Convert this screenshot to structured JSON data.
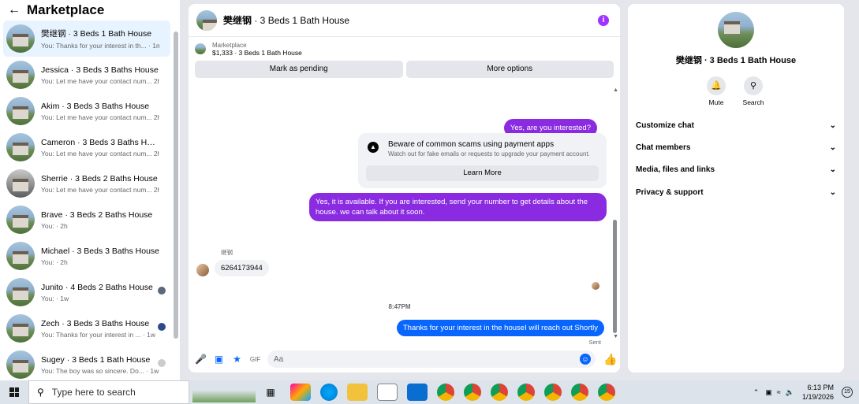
{
  "left": {
    "title": "Marketplace",
    "conversations": [
      {
        "title": "樊继钢 · 3 Beds 1 Bath House",
        "sub": "You: Thanks for your interest in th... · 1m"
      },
      {
        "title": "Jessica · 3 Beds 3 Baths House",
        "sub": "You: Let me have your contact num... 2h"
      },
      {
        "title": "Akim · 3 Beds 3 Baths House",
        "sub": "You: Let me have your contact num... 2h"
      },
      {
        "title": "Cameron · 3 Beds 3 Baths House",
        "sub": "You: Let me have your contact num... 2h"
      },
      {
        "title": "Sherrie · 3 Beds 2 Baths House",
        "sub": "You: Let me have your contact num... 2h"
      },
      {
        "title": "Brave · 3 Beds 2 Baths House",
        "sub": "You: · 2h"
      },
      {
        "title": "Michael · 3 Beds 3 Baths House",
        "sub": "You: · 2h"
      },
      {
        "title": "Junito · 4 Beds 2 Baths House",
        "sub": "You: · 1w"
      },
      {
        "title": "Zech · 3 Beds 3 Baths House",
        "sub": "You: Thanks for your interest in ... · 1w"
      },
      {
        "title": "Sugey · 3 Beds 1 Bath House",
        "sub": "You: The boy was so sincere. Do... · 1w"
      }
    ]
  },
  "chat": {
    "name": "樊继钢",
    "title_rest": " · 3 Beds 1 Bath House",
    "listing_label": "Marketplace",
    "listing_price": "$1,333 · 3 Beds 1 Bath House",
    "mark_pending": "Mark as pending",
    "more_options": "More options",
    "msg_interested": "Yes, are you interested?",
    "warn_title": "Beware of common scams using payment apps",
    "warn_sub": "Watch out for fake emails or requests to upgrade your payment account.",
    "learn_more": "Learn More",
    "msg_available": "Yes, it is available. If you are interested, send your number to get details about the house. we can talk about it soon.",
    "sender_name": "继钢",
    "msg_number": "6264173944",
    "timestamp": "8:47PM",
    "msg_thanks": "Thanks for your interest in the houseI will reach out Shortly",
    "sent": "Sent",
    "input_placeholder": "Aa"
  },
  "right": {
    "title": "樊继钢 · 3 Beds 1 Bath House",
    "mute": "Mute",
    "search": "Search",
    "sections": [
      "Customize chat",
      "Chat members",
      "Media, files and links",
      "Privacy & support"
    ]
  },
  "taskbar": {
    "search_placeholder": "Type here to search",
    "time": "6:13 PM",
    "date": "1/19/2026",
    "notifications": "15"
  }
}
